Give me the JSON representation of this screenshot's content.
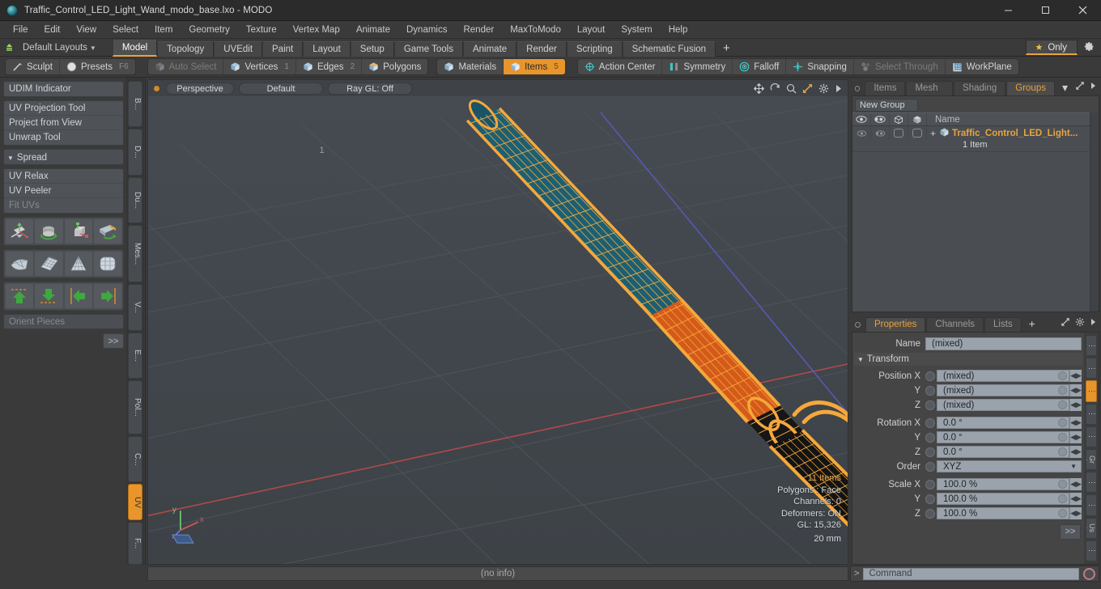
{
  "window": {
    "title": "Traffic_Control_LED_Light_Wand_modo_base.lxo - MODO",
    "minimize": "—",
    "maximize": "▢",
    "close": "✕"
  },
  "menu": [
    "File",
    "Edit",
    "View",
    "Select",
    "Item",
    "Geometry",
    "Texture",
    "Vertex Map",
    "Animate",
    "Dynamics",
    "Render",
    "MaxToModo",
    "Layout",
    "System",
    "Help"
  ],
  "layoutbar": {
    "layouts_label": "Default Layouts",
    "tabs": [
      "Model",
      "Topology",
      "UVEdit",
      "Paint",
      "Layout",
      "Setup",
      "Game Tools",
      "Animate",
      "Render",
      "Scripting",
      "Schematic Fusion"
    ],
    "active_tab": "Model",
    "add_tab": "+",
    "only_label": "Only"
  },
  "modebar": {
    "left_group": [
      {
        "label": "Sculpt",
        "icon": "pen-icon",
        "state": "normal"
      },
      {
        "label": "Presets",
        "icon": "sphere-icon",
        "state": "normal",
        "shortcut": "F6"
      }
    ],
    "select_group": [
      {
        "label": "Auto Select",
        "icon": "cube-icon",
        "state": "dim",
        "count": ""
      },
      {
        "label": "Vertices",
        "icon": "cube-icon",
        "state": "normal",
        "count": "1"
      },
      {
        "label": "Edges",
        "icon": "cube-icon",
        "state": "normal",
        "count": "2"
      },
      {
        "label": "Polygons",
        "icon": "cube-icon",
        "state": "normal",
        "count": ""
      },
      {
        "label": "Materials",
        "icon": "cube-icon",
        "state": "normal",
        "count": ""
      },
      {
        "label": "Items",
        "icon": "cube-icon",
        "state": "selected",
        "count": "5"
      }
    ],
    "tool_group": [
      {
        "label": "Action Center",
        "icon": "crosshair-icon",
        "state": "normal"
      },
      {
        "label": "Symmetry",
        "icon": "mirror-icon",
        "state": "normal"
      },
      {
        "label": "Falloff",
        "icon": "target-icon",
        "state": "normal"
      },
      {
        "label": "Snapping",
        "icon": "snap-icon",
        "state": "normal"
      },
      {
        "label": "Select Through",
        "icon": "selectthrough-icon",
        "state": "dim"
      },
      {
        "label": "WorkPlane",
        "icon": "workplane-icon",
        "state": "normal"
      }
    ]
  },
  "left_panel": {
    "block1": [
      {
        "label": "UDIM Indicator",
        "dim": false
      }
    ],
    "block2": [
      {
        "label": "UV Projection Tool",
        "dim": false
      },
      {
        "label": "Project from View",
        "dim": false
      },
      {
        "label": "Unwrap Tool",
        "dim": false
      }
    ],
    "spread_label": "Spread",
    "block3": [
      {
        "label": "UV Relax",
        "dim": false
      },
      {
        "label": "UV Peeler",
        "dim": false
      },
      {
        "label": "Fit UVs",
        "dim": true
      }
    ],
    "icon_row_1": [
      "move-axis-icon",
      "rotate-icon",
      "scale-axis-icon",
      "flip-icon"
    ],
    "icon_row_2": [
      "quad-patch-icon",
      "uv-grid-icon",
      "cone-uv-icon",
      "sphere-uv-icon"
    ],
    "icon_row_3": [
      "arrow-up-icon",
      "arrow-down-icon",
      "arrow-left-icon",
      "arrow-right-icon"
    ],
    "orient_placeholder": "Orient Pieces",
    "more_button": ">>",
    "vtabs": [
      {
        "label": "B...",
        "active": false
      },
      {
        "label": "D...",
        "active": false
      },
      {
        "label": "Du...",
        "active": false
      },
      {
        "label": "Mes...",
        "active": false
      },
      {
        "label": "V...",
        "active": false
      },
      {
        "label": "E...",
        "active": false
      },
      {
        "label": "Pol...",
        "active": false
      },
      {
        "label": "C...",
        "active": false
      },
      {
        "label": "UV",
        "active": true
      },
      {
        "label": "F...",
        "active": false
      }
    ]
  },
  "viewport": {
    "view_mode": "Perspective",
    "shading": "Default",
    "raygl": "Ray GL: Off",
    "icons": [
      "move-icon",
      "rotate-icon",
      "zoom-icon",
      "fit-icon",
      "gear-icon",
      "expand-arrow-icon"
    ],
    "info": {
      "items": "11 Items",
      "polygons": "Polygons : Face",
      "channels": "Channels: 0",
      "deformers": "Deformers: ON",
      "gl": "GL: 15,326"
    },
    "scale": "20 mm",
    "colors": {
      "background": "#41474c",
      "selection_orange": "#f5a83c",
      "body_orange": "#d45a1a",
      "tip_teal": "#1c5f73",
      "handle_dark": "#141414",
      "axis_x": "#b84a4a",
      "axis_z": "#5a5ac0",
      "grid": "#4e545a"
    }
  },
  "right_panel": {
    "top_tabs": [
      {
        "label": "Items",
        "active": false
      },
      {
        "label": "Mesh ...",
        "active": false
      },
      {
        "label": "Shading",
        "active": false
      },
      {
        "label": "Groups",
        "active": true
      }
    ],
    "top_tabs_caret": "▾",
    "new_group_label": "New Group",
    "grid_headers": [
      "eye-icon",
      "render-icon",
      "cube-outline-icon",
      "cube-shaded-icon"
    ],
    "name_column": "Name",
    "rows": [
      {
        "title": "Traffic_Control_LED_Light...",
        "subtitle": "1 Item",
        "expander": "+"
      }
    ],
    "props_tabs": [
      {
        "label": "Properties",
        "active": true
      },
      {
        "label": "Channels",
        "active": false
      },
      {
        "label": "Lists",
        "active": false
      }
    ],
    "props_add": "+",
    "name_label": "Name",
    "name_value": "(mixed)",
    "transform_label": "Transform",
    "properties": [
      {
        "label": "Position X",
        "value": "(mixed)",
        "type": "field"
      },
      {
        "label": "Y",
        "value": "(mixed)",
        "type": "field"
      },
      {
        "label": "Z",
        "value": "(mixed)",
        "type": "field"
      },
      {
        "label": "Rotation X",
        "value": "0.0 °",
        "type": "field"
      },
      {
        "label": "Y",
        "value": "0.0 °",
        "type": "field"
      },
      {
        "label": "Z",
        "value": "0.0 °",
        "type": "field"
      },
      {
        "label": "Order",
        "value": "XYZ",
        "type": "dropdown"
      },
      {
        "label": "Scale X",
        "value": "100.0 %",
        "type": "field"
      },
      {
        "label": "Y",
        "value": "100.0 %",
        "type": "field"
      },
      {
        "label": "Z",
        "value": "100.0 %",
        "type": "field"
      }
    ],
    "more_button": ">>",
    "vtabs": [
      {
        "label": "⋮",
        "active": false
      },
      {
        "label": "⋮",
        "active": false
      },
      {
        "label": "⋮",
        "active": true
      },
      {
        "label": "⋮",
        "active": false
      },
      {
        "label": "⋮",
        "active": false
      },
      {
        "label": "Gr ⋮",
        "active": false
      },
      {
        "label": "⋮",
        "active": false
      },
      {
        "label": "⋮",
        "active": false
      },
      {
        "label": "Us ⋮",
        "active": false
      },
      {
        "label": "⋮",
        "active": false
      }
    ]
  },
  "bottom": {
    "status": "(no info)",
    "command_prompt": ">",
    "command_placeholder": "Command"
  }
}
